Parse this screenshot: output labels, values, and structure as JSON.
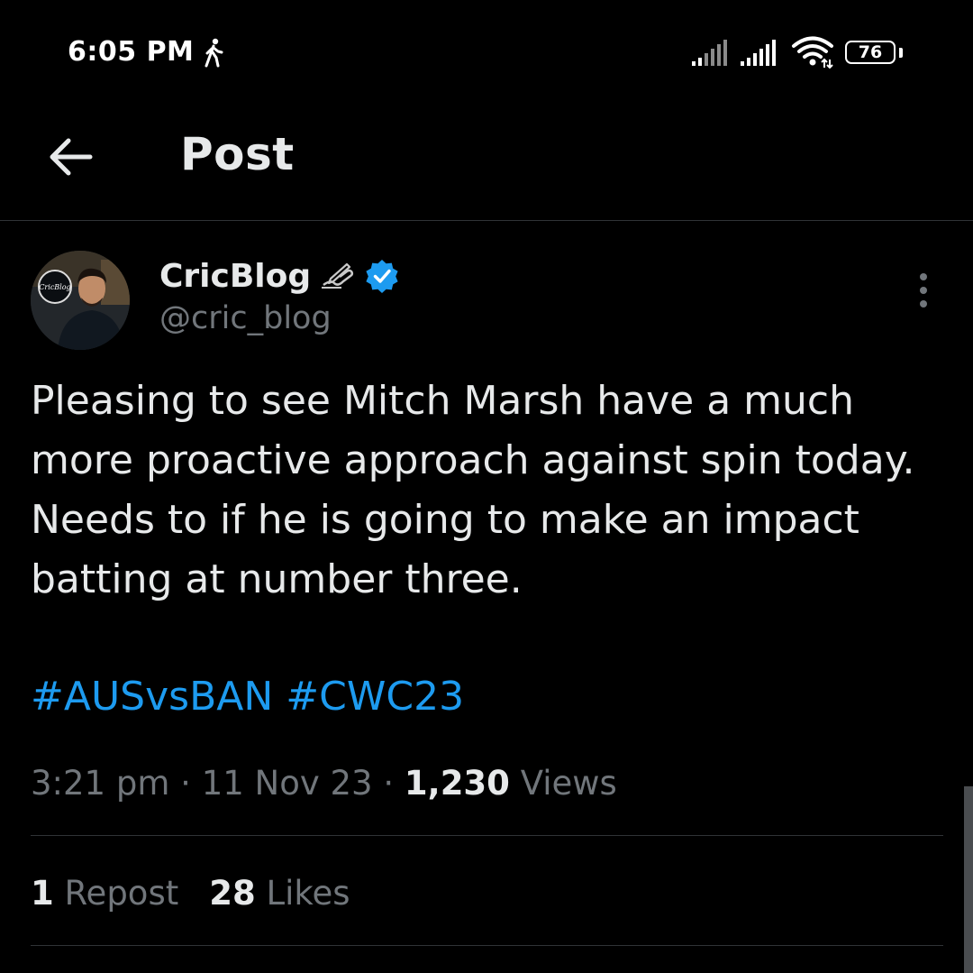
{
  "status_bar": {
    "time": "6:05 PM",
    "battery_level": "76",
    "icons": [
      "walking-icon",
      "signal-icon",
      "signal-icon",
      "wifi-icon",
      "battery-icon"
    ]
  },
  "header": {
    "title": "Post",
    "back_icon": "arrow-left-icon"
  },
  "author": {
    "display_name": "CricBlog",
    "handle": "@cric_blog",
    "avatar_badge_text": "CricBlog",
    "verified": true,
    "name_emoji_icon": "writing-hand-icon",
    "more_icon": "vertical-ellipsis-icon"
  },
  "post": {
    "text": "Pleasing to see Mitch Marsh have a much more proactive approach against spin today. Needs to if he is going to make an impact batting at number three.",
    "hashtags": [
      "#AUSvsBAN",
      "#CWC23"
    ],
    "time": "3:21 pm",
    "separator": "·",
    "date": "11 Nov 23",
    "views_count": "1,230",
    "views_label": "Views"
  },
  "stats": {
    "reposts_count": "1",
    "reposts_label": "Repost",
    "likes_count": "28",
    "likes_label": "Likes"
  },
  "colors": {
    "background": "#000000",
    "text_primary": "#e7e9ea",
    "text_secondary": "#71767b",
    "link": "#1d9bf0",
    "verified": "#1d9bf0",
    "divider": "#2f3336"
  }
}
